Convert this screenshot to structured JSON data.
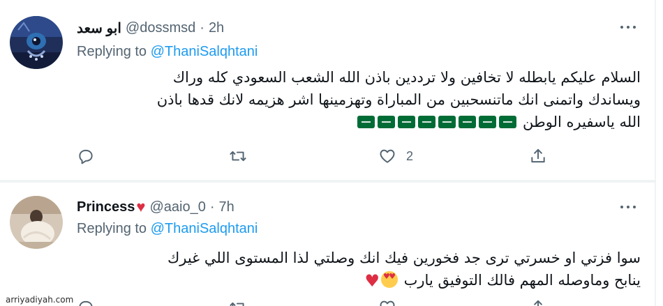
{
  "tweets": [
    {
      "author": {
        "name": "ابو سعد",
        "handle": "@dossmsd"
      },
      "separator": "·",
      "time": "2h",
      "replying_prefix": "Replying to",
      "replying_to": "@ThaniSalqhtani",
      "text_lines": [
        "السلام عليكم يابطله لا تخافين ولا ترددين باذن الله الشعب السعودي كله وراك",
        "ويساندك واتمنى انك ماتنسحبين من المباراة وتهزمينها اشر هزيمه لانك قدها باذن",
        "الله ياسفيره الوطن"
      ],
      "emoji": {
        "name": "saudi-flag",
        "count": 8
      },
      "actions": {
        "reply_count": "",
        "retweet_count": "",
        "like_count": "2"
      },
      "colors": {
        "flag": "#006c35"
      }
    },
    {
      "author": {
        "name": "Princess",
        "name_emoji": "♥",
        "handle": "@aaio_0"
      },
      "separator": "·",
      "time": "7h",
      "replying_prefix": "Replying to",
      "replying_to": "@ThaniSalqhtani",
      "text_lines": [
        "سوا فزتي او خسرتي ترى جد فخورين فيك انك وصلتي لذا المستوى اللي غيرك",
        "ينابح وماوصله المهم فالك التوفيق يارب"
      ],
      "emoji": [
        "smiling-face-with-heart-eyes",
        "red-heart"
      ],
      "colors": {
        "heart": "#dd2e44"
      }
    }
  ],
  "theme": {
    "link": "#1d9bf0",
    "secondary_text": "#536471",
    "primary_text": "#0f1419",
    "divider": "#eff3f4"
  },
  "watermark": "arriyadiyah.com"
}
